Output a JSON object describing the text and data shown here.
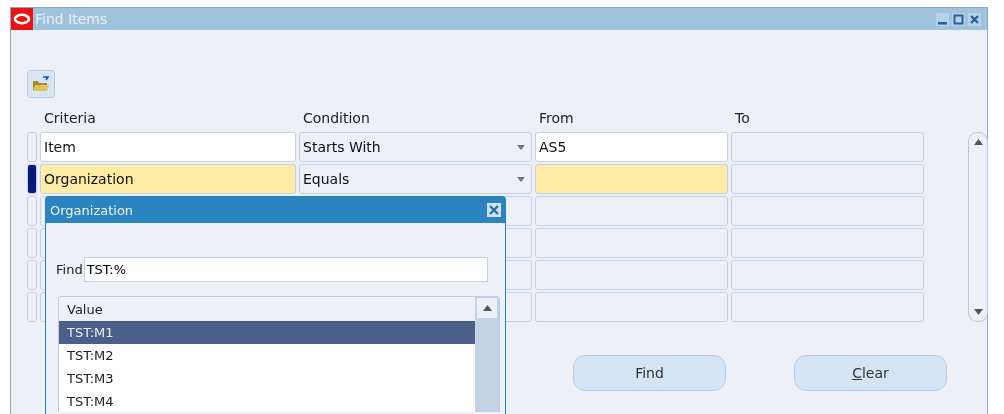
{
  "window": {
    "title": "Find Items"
  },
  "table": {
    "columns": [
      "Criteria",
      "Condition",
      "From",
      "To"
    ],
    "rows": [
      {
        "criteria": "Item",
        "condition": "Starts With",
        "from": "AS5",
        "selected": false
      },
      {
        "criteria": "Organization",
        "condition": "Equals",
        "selected": true
      },
      {
        "selected": false
      },
      {
        "selected": false
      },
      {
        "selected": false
      },
      {
        "selected": false
      }
    ]
  },
  "buttons": [
    {
      "label": "Find",
      "underline_first": false
    },
    {
      "label": "Clear",
      "underline_first": true
    }
  ],
  "popup": {
    "title": "Organization",
    "find_label": "Find",
    "find_value": "TST:%",
    "list_header": "Value",
    "items": [
      {
        "label": "TST:M1",
        "selected": true
      },
      {
        "label": "TST:M2",
        "selected": false
      },
      {
        "label": "TST:M3",
        "selected": false
      },
      {
        "label": "TST:M4",
        "selected": false
      }
    ]
  }
}
